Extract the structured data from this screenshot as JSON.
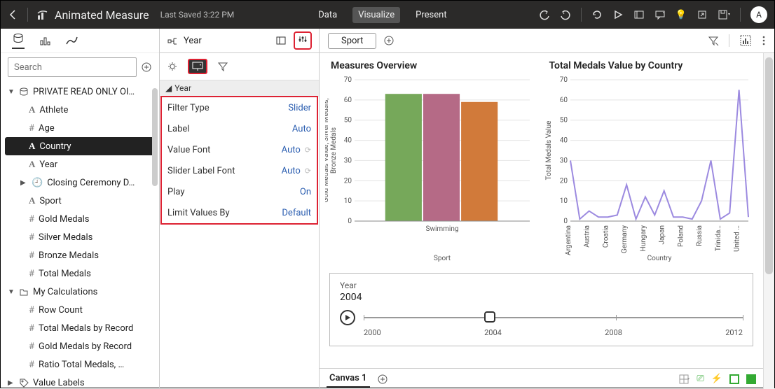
{
  "header": {
    "title": "Animated Measure",
    "last_saved": "Last Saved 3:22 PM",
    "modes": [
      "Data",
      "Visualize",
      "Present"
    ],
    "active_mode": "Visualize",
    "avatar": "A"
  },
  "sidebar": {
    "search_placeholder": "Search",
    "tree": {
      "root": "PRIVATE READ ONLY OI…",
      "fields": [
        {
          "icon": "A",
          "label": "Athlete"
        },
        {
          "icon": "#",
          "label": "Age"
        },
        {
          "icon": "A",
          "label": "Country",
          "selected": true
        },
        {
          "icon": "A",
          "label": "Year"
        },
        {
          "icon": "clock",
          "label": "Closing Ceremony D…",
          "expandable": true
        },
        {
          "icon": "A",
          "label": "Sport"
        },
        {
          "icon": "#",
          "label": "Gold Medals"
        },
        {
          "icon": "#",
          "label": "Silver Medals"
        },
        {
          "icon": "#",
          "label": "Bronze Medals"
        },
        {
          "icon": "#",
          "label": "Total Medals"
        }
      ],
      "calc_folder": "My Calculations",
      "calcs": [
        {
          "icon": "#",
          "label": "Row Count"
        },
        {
          "icon": "#",
          "label": "Total Medals by Record"
        },
        {
          "icon": "#",
          "label": "Gold Medals by Record"
        },
        {
          "icon": "#",
          "label": "Ratio Total Medals, …"
        }
      ],
      "value_labels": "Value Labels"
    }
  },
  "midpanel": {
    "top_label": "Year",
    "section": "Year",
    "properties": [
      {
        "name": "Filter Type",
        "value": "Slider",
        "refresh": false
      },
      {
        "name": "Label",
        "value": "Auto",
        "refresh": false
      },
      {
        "name": "Value Font",
        "value": "Auto",
        "refresh": true
      },
      {
        "name": "Slider Label Font",
        "value": "Auto",
        "refresh": true
      },
      {
        "name": "Play",
        "value": "On",
        "refresh": false
      },
      {
        "name": "Limit Values By",
        "value": "Default",
        "refresh": false
      }
    ]
  },
  "canvas": {
    "pill": "Sport",
    "bottom_tab": "Canvas 1",
    "slider": {
      "label": "Year",
      "current": "2004",
      "ticks": [
        "2000",
        "2004",
        "2008",
        "2012"
      ]
    }
  },
  "chart_data": [
    {
      "type": "bar",
      "title": "Measures Overview",
      "xlabel": "Sport",
      "ylabel": "Gold Medals Value, Silver Medals, Bronze Medals",
      "categories": [
        "Swimming"
      ],
      "series": [
        {
          "name": "Gold Medals Value",
          "values": [
            63
          ],
          "color": "#76a85a"
        },
        {
          "name": "Silver Medals",
          "values": [
            63
          ],
          "color": "#b56a86"
        },
        {
          "name": "Bronze Medals",
          "values": [
            59
          ],
          "color": "#d17a3a"
        }
      ],
      "ylim": [
        0,
        70
      ],
      "yticks": [
        0,
        10,
        20,
        30,
        40,
        50,
        60,
        70
      ]
    },
    {
      "type": "line",
      "title": "Total Medals Value by Country",
      "xlabel": "Country",
      "ylabel": "Total Medals Value",
      "categories": [
        "Argentina",
        "Austria",
        "Croatia",
        "Germany",
        "Hungary",
        "Japan",
        "Poland",
        "Russia",
        "Trinida…",
        "United …"
      ],
      "series": [
        {
          "name": "Total Medals Value",
          "color": "#9c8ae0",
          "x": [
            0,
            0.5,
            1,
            1.5,
            2,
            2.5,
            3,
            3.5,
            4,
            4.5,
            5,
            5.5,
            6,
            6.5,
            7,
            7.5,
            8,
            8.5,
            9,
            9.5
          ],
          "y": [
            30,
            1,
            5,
            2,
            2,
            3,
            18,
            1,
            12,
            3,
            15,
            2,
            2,
            1,
            10,
            30,
            1,
            4,
            65,
            2
          ]
        }
      ],
      "ylim": [
        0,
        70
      ],
      "yticks": [
        0,
        10,
        20,
        30,
        40,
        50,
        60,
        70
      ]
    }
  ]
}
